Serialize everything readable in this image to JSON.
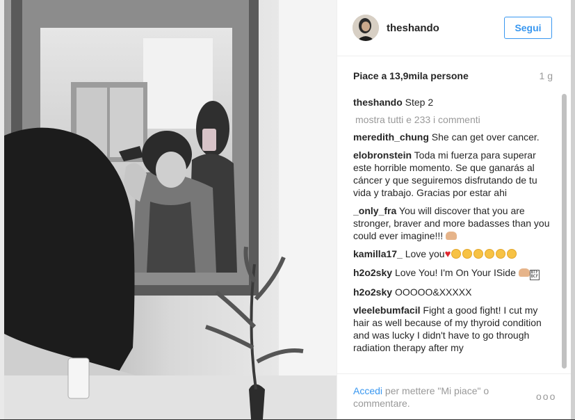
{
  "post": {
    "username": "theshando",
    "follow_label": "Segui",
    "likes": "Piace a 13,9mila persone",
    "age": "1 g",
    "caption_user": "theshando",
    "caption_text": "Step 2",
    "view_all": "mostra tutti e 233 i commenti"
  },
  "comments": [
    {
      "user": "meredith_chung",
      "text": "She can get over cancer."
    },
    {
      "user": "elobronstein",
      "text": "Toda mi fuerza para superar este horrible momento. Se que ganarás al cáncer y que seguiremos disfrutando de tu vida y trabajo. Gracias por estar ahi"
    },
    {
      "user": "_only_fra",
      "text": "You will discover that you are stronger, braver and more badasses than you could ever imagine!!!"
    },
    {
      "user": "kamilla17_",
      "text": "Love you"
    },
    {
      "user": "h2o2sky",
      "text": "Love You! I'm On Your ISide"
    },
    {
      "user": "h2o2sky",
      "text": "OOOOO&XXXXX"
    },
    {
      "user": "vleelebumfacil",
      "text": "Fight a good fight! I cut my hair as well because of my thyroid condition and was lucky I didn't have to go through radiation therapy after my"
    }
  ],
  "footer": {
    "login_link": "Accedi",
    "login_text": "per mettere \"Mi piace\" o commentare.",
    "more_icon": "more-options-icon",
    "dots": "ooo"
  },
  "emoji": {
    "flexed_biceps": "flexed-biceps-emoji",
    "red_heart": "heart-emoji",
    "smiling_face": "heart-eyes-emoji",
    "box": "box-emoji",
    "box_glyph": "BTF BCF"
  }
}
